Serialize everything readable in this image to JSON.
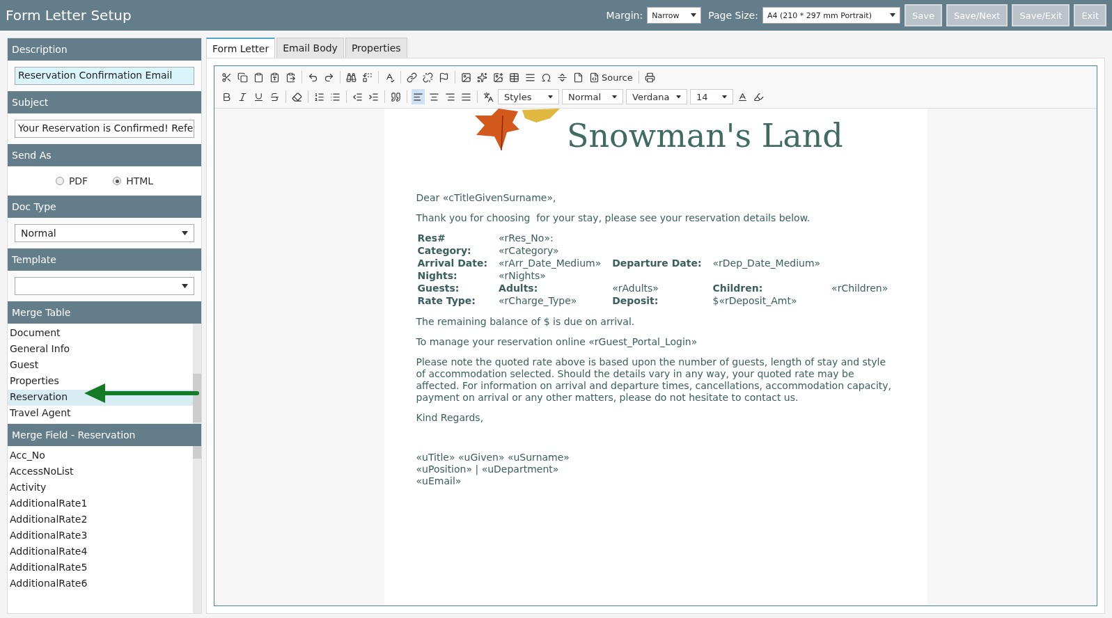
{
  "header": {
    "title": "Form Letter Setup",
    "margin_label": "Margin:",
    "margin_value": "Narrow",
    "page_size_label": "Page Size:",
    "page_size_value": "A4 (210 * 297 mm Portrait)",
    "buttons": [
      "Save",
      "Save/Next",
      "Save/Exit",
      "Exit"
    ]
  },
  "sidebar": {
    "description": {
      "heading": "Description",
      "value": "Reservation Confirmation Email"
    },
    "subject": {
      "heading": "Subject",
      "value": "Your Reservation is Confirmed! Refe"
    },
    "send_as": {
      "heading": "Send As",
      "options": [
        {
          "label": "PDF",
          "selected": false
        },
        {
          "label": "HTML",
          "selected": true
        }
      ]
    },
    "doc_type": {
      "heading": "Doc Type",
      "value": "Normal"
    },
    "template": {
      "heading": "Template"
    },
    "merge_table": {
      "heading": "Merge Table",
      "items": [
        {
          "label": "Document",
          "selected": false
        },
        {
          "label": "General Info",
          "selected": false
        },
        {
          "label": "Guest",
          "selected": false
        },
        {
          "label": "Properties",
          "selected": false
        },
        {
          "label": "Reservation",
          "selected": true
        },
        {
          "label": "Travel Agent",
          "selected": false
        }
      ]
    },
    "merge_field": {
      "heading": "Merge Field - Reservation",
      "items": [
        "Acc_No",
        "AccessNoList",
        "Activity",
        "AdditionalRate1",
        "AdditionalRate2",
        "AdditionalRate3",
        "AdditionalRate4",
        "AdditionalRate5",
        "AdditionalRate6"
      ]
    }
  },
  "tabs": [
    {
      "label": "Form Letter",
      "selected": true
    },
    {
      "label": "Email Body",
      "selected": false
    },
    {
      "label": "Properties",
      "selected": false
    }
  ],
  "toolbar": {
    "source": "Source",
    "styles": "Styles",
    "format": "Normal",
    "font": "Verdana",
    "size": "14"
  },
  "letter": {
    "title": "Snowman's Land",
    "greeting": "Dear «cTitleGivenSurname»,",
    "intro": "Thank you for choosing  for your stay, please see your reservation details below.",
    "details": [
      [
        {
          "text": "Res#",
          "bold": true
        },
        {
          "text": "«rRes_No»:",
          "bold": false
        }
      ],
      [
        {
          "text": "Category:",
          "bold": true
        },
        {
          "text": "«rCategory»",
          "bold": false
        }
      ],
      [
        {
          "text": "Arrival Date:",
          "bold": true
        },
        {
          "text": "«rArr_Date_Medium»",
          "bold": false
        },
        {
          "text": "Departure Date:",
          "bold": true
        },
        {
          "text": "«rDep_Date_Medium»",
          "bold": false
        }
      ],
      [
        {
          "text": "Nights:",
          "bold": true
        },
        {
          "text": "«rNights»",
          "bold": false
        }
      ],
      [
        {
          "text": "Guests:",
          "bold": true
        },
        {
          "text": "Adults:",
          "bold": true
        },
        {
          "text": "«rAdults»",
          "bold": false
        },
        {
          "text": "Children:",
          "bold": true
        },
        {
          "text": "«rChildren»",
          "bold": false
        }
      ],
      [
        {
          "text": "Rate Type:",
          "bold": true
        },
        {
          "text": "«rCharge_Type»",
          "bold": false
        },
        {
          "text": "Deposit:",
          "bold": true
        },
        {
          "text": "$«rDeposit_Amt»",
          "bold": false
        }
      ]
    ],
    "paragraphs": [
      "The remaining balance of $ is due on arrival.",
      "To manage your reservation online «rGuest_Portal_Login»",
      "Please note the quoted rate above is based upon the number of guests, length of stay and style of accommodation selected. Should the details vary in any way, your quoted rate may be affected. For information on arrival and departure times, cancellations, accommodation capacity, payment on arrival or any other matters, please do not hesitate to contact us.",
      "Kind Regards,"
    ],
    "signature": [
      "«uTitle» «uGiven» «uSurname»",
      "«uPosition» | «uDepartment»",
      "«uEmail»"
    ]
  }
}
